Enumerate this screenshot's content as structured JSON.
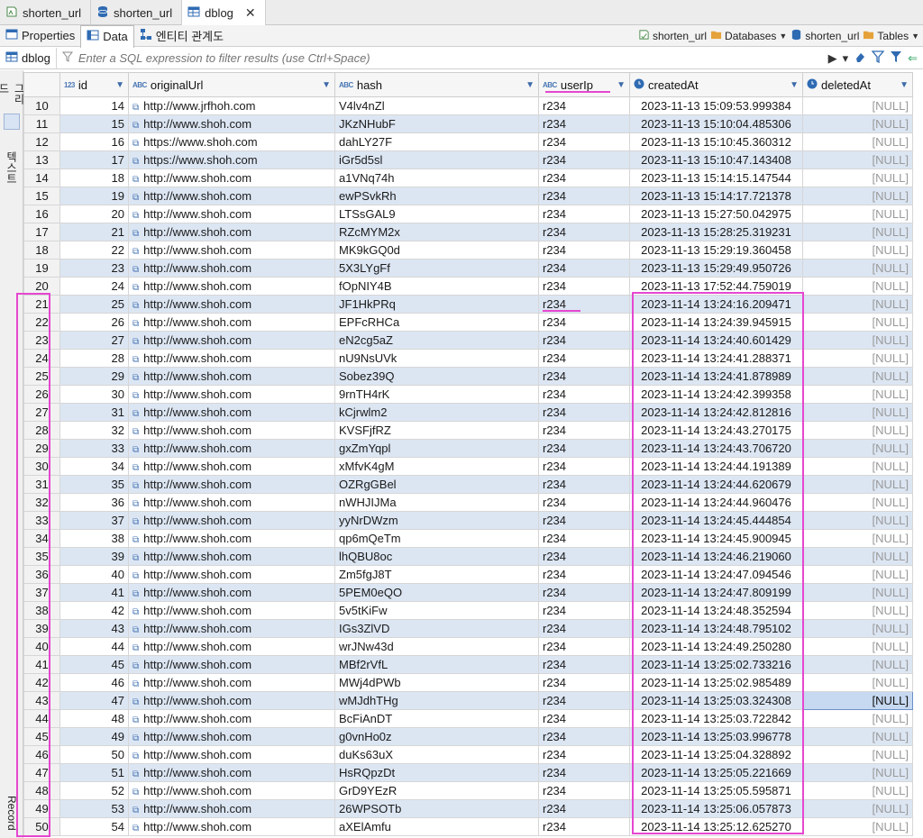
{
  "tabs": [
    {
      "label": "shorten_url",
      "icon": "sql-editor-icon"
    },
    {
      "label": "shorten_url",
      "icon": "database-icon"
    },
    {
      "label": "dblog",
      "icon": "table-icon",
      "active": true
    }
  ],
  "subtabs": [
    {
      "label": "Properties"
    },
    {
      "label": "Data",
      "active": true
    },
    {
      "label": "엔티티 관계도"
    }
  ],
  "breadcrumbs": [
    "shorten_url",
    "Databases",
    "shorten_url",
    "Tables"
  ],
  "filter": {
    "table_label": "dblog",
    "placeholder": "Enter a SQL expression to filter results (use Ctrl+Space)"
  },
  "side": {
    "grid_label": "그리드",
    "text_label": "텍스트",
    "record_label": "Record"
  },
  "columns": [
    {
      "name": "id",
      "type": "123"
    },
    {
      "name": "originalUrl",
      "type": "ABC"
    },
    {
      "name": "hash",
      "type": "ABC"
    },
    {
      "name": "userIp",
      "type": "ABC"
    },
    {
      "name": "createdAt",
      "type": "clock"
    },
    {
      "name": "deletedAt",
      "type": "clock"
    }
  ],
  "rows": [
    [
      "10",
      "14",
      "http://www.jrfhoh.com",
      "V4lv4nZl",
      "r234",
      "2023-11-13 15:09:53.999384",
      "[NULL]"
    ],
    [
      "11",
      "15",
      "http://www.shoh.com",
      "JKzNHubF",
      "r234",
      "2023-11-13 15:10:04.485306",
      "[NULL]"
    ],
    [
      "12",
      "16",
      "https://www.shoh.com",
      "dahLY27F",
      "r234",
      "2023-11-13 15:10:45.360312",
      "[NULL]"
    ],
    [
      "13",
      "17",
      "https://www.shoh.com",
      "iGr5d5sl",
      "r234",
      "2023-11-13 15:10:47.143408",
      "[NULL]"
    ],
    [
      "14",
      "18",
      "http://www.shoh.com",
      "a1VNq74h",
      "r234",
      "2023-11-13 15:14:15.147544",
      "[NULL]"
    ],
    [
      "15",
      "19",
      "http://www.shoh.com",
      "ewPSvkRh",
      "r234",
      "2023-11-13 15:14:17.721378",
      "[NULL]"
    ],
    [
      "16",
      "20",
      "http://www.shoh.com",
      "LTSsGAL9",
      "r234",
      "2023-11-13 15:27:50.042975",
      "[NULL]"
    ],
    [
      "17",
      "21",
      "http://www.shoh.com",
      "RZcMYM2x",
      "r234",
      "2023-11-13 15:28:25.319231",
      "[NULL]"
    ],
    [
      "18",
      "22",
      "http://www.shoh.com",
      "MK9kGQ0d",
      "r234",
      "2023-11-13 15:29:19.360458",
      "[NULL]"
    ],
    [
      "19",
      "23",
      "http://www.shoh.com",
      "5X3LYgFf",
      "r234",
      "2023-11-13 15:29:49.950726",
      "[NULL]"
    ],
    [
      "20",
      "24",
      "http://www.shoh.com",
      "fOpNIY4B",
      "r234",
      "2023-11-13 17:52:44.759019",
      "[NULL]"
    ],
    [
      "21",
      "25",
      "http://www.shoh.com",
      "JF1HkPRq",
      "r234",
      "2023-11-14 13:24:16.209471",
      "[NULL]"
    ],
    [
      "22",
      "26",
      "http://www.shoh.com",
      "EPFcRHCa",
      "r234",
      "2023-11-14 13:24:39.945915",
      "[NULL]"
    ],
    [
      "23",
      "27",
      "http://www.shoh.com",
      "eN2cg5aZ",
      "r234",
      "2023-11-14 13:24:40.601429",
      "[NULL]"
    ],
    [
      "24",
      "28",
      "http://www.shoh.com",
      "nU9NsUVk",
      "r234",
      "2023-11-14 13:24:41.288371",
      "[NULL]"
    ],
    [
      "25",
      "29",
      "http://www.shoh.com",
      "Sobez39Q",
      "r234",
      "2023-11-14 13:24:41.878989",
      "[NULL]"
    ],
    [
      "26",
      "30",
      "http://www.shoh.com",
      "9rnTH4rK",
      "r234",
      "2023-11-14 13:24:42.399358",
      "[NULL]"
    ],
    [
      "27",
      "31",
      "http://www.shoh.com",
      "kCjrwlm2",
      "r234",
      "2023-11-14 13:24:42.812816",
      "[NULL]"
    ],
    [
      "28",
      "32",
      "http://www.shoh.com",
      "KVSFjfRZ",
      "r234",
      "2023-11-14 13:24:43.270175",
      "[NULL]"
    ],
    [
      "29",
      "33",
      "http://www.shoh.com",
      "gxZmYqpl",
      "r234",
      "2023-11-14 13:24:43.706720",
      "[NULL]"
    ],
    [
      "30",
      "34",
      "http://www.shoh.com",
      "xMfvK4gM",
      "r234",
      "2023-11-14 13:24:44.191389",
      "[NULL]"
    ],
    [
      "31",
      "35",
      "http://www.shoh.com",
      "OZRgGBel",
      "r234",
      "2023-11-14 13:24:44.620679",
      "[NULL]"
    ],
    [
      "32",
      "36",
      "http://www.shoh.com",
      "nWHJIJMa",
      "r234",
      "2023-11-14 13:24:44.960476",
      "[NULL]"
    ],
    [
      "33",
      "37",
      "http://www.shoh.com",
      "yyNrDWzm",
      "r234",
      "2023-11-14 13:24:45.444854",
      "[NULL]"
    ],
    [
      "34",
      "38",
      "http://www.shoh.com",
      "qp6mQeTm",
      "r234",
      "2023-11-14 13:24:45.900945",
      "[NULL]"
    ],
    [
      "35",
      "39",
      "http://www.shoh.com",
      "lhQBU8oc",
      "r234",
      "2023-11-14 13:24:46.219060",
      "[NULL]"
    ],
    [
      "36",
      "40",
      "http://www.shoh.com",
      "Zm5fgJ8T",
      "r234",
      "2023-11-14 13:24:47.094546",
      "[NULL]"
    ],
    [
      "37",
      "41",
      "http://www.shoh.com",
      "5PEM0eQO",
      "r234",
      "2023-11-14 13:24:47.809199",
      "[NULL]"
    ],
    [
      "38",
      "42",
      "http://www.shoh.com",
      "5v5tKiFw",
      "r234",
      "2023-11-14 13:24:48.352594",
      "[NULL]"
    ],
    [
      "39",
      "43",
      "http://www.shoh.com",
      "IGs3ZlVD",
      "r234",
      "2023-11-14 13:24:48.795102",
      "[NULL]"
    ],
    [
      "40",
      "44",
      "http://www.shoh.com",
      "wrJNw43d",
      "r234",
      "2023-11-14 13:24:49.250280",
      "[NULL]"
    ],
    [
      "41",
      "45",
      "http://www.shoh.com",
      "MBf2rVfL",
      "r234",
      "2023-11-14 13:25:02.733216",
      "[NULL]"
    ],
    [
      "42",
      "46",
      "http://www.shoh.com",
      "MWj4dPWb",
      "r234",
      "2023-11-14 13:25:02.985489",
      "[NULL]"
    ],
    [
      "43",
      "47",
      "http://www.shoh.com",
      "wMJdhTHg",
      "r234",
      "2023-11-14 13:25:03.324308",
      "[NULL]"
    ],
    [
      "44",
      "48",
      "http://www.shoh.com",
      "BcFiAnDT",
      "r234",
      "2023-11-14 13:25:03.722842",
      "[NULL]"
    ],
    [
      "45",
      "49",
      "http://www.shoh.com",
      "g0vnHo0z",
      "r234",
      "2023-11-14 13:25:03.996778",
      "[NULL]"
    ],
    [
      "46",
      "50",
      "http://www.shoh.com",
      "duKs63uX",
      "r234",
      "2023-11-14 13:25:04.328892",
      "[NULL]"
    ],
    [
      "47",
      "51",
      "http://www.shoh.com",
      "HsRQpzDt",
      "r234",
      "2023-11-14 13:25:05.221669",
      "[NULL]"
    ],
    [
      "48",
      "52",
      "http://www.shoh.com",
      "GrD9YEzR",
      "r234",
      "2023-11-14 13:25:05.595871",
      "[NULL]"
    ],
    [
      "49",
      "53",
      "http://www.shoh.com",
      "26WPSOTb",
      "r234",
      "2023-11-14 13:25:06.057873",
      "[NULL]"
    ],
    [
      "50",
      "54",
      "http://www.shoh.com",
      "aXElAmfu",
      "r234",
      "2023-11-14 13:25:12.625270",
      "[NULL]"
    ]
  ],
  "selected_row": "43",
  "colors": {
    "accent": "#3c6aa8",
    "row_alt": "#dce6f3",
    "annotation": "#e547d0",
    "null_text": "#9a9a9a"
  }
}
